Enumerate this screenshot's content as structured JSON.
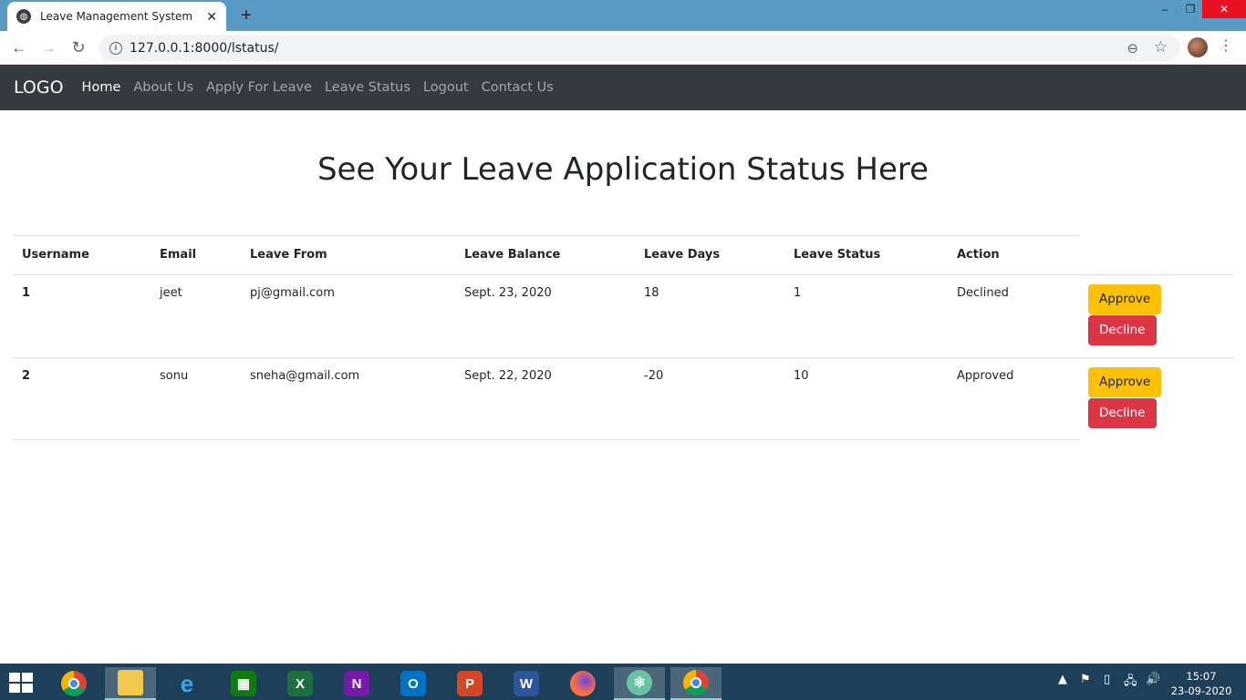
{
  "browser": {
    "tab_title": "Leave Management System",
    "tab_close": "✕",
    "new_tab": "+",
    "url": "127.0.0.1:8000/lstatus/",
    "window_controls": [
      "–",
      "❐",
      "✕"
    ]
  },
  "navbar": {
    "brand": "LOGO",
    "links": [
      "Home",
      "About Us",
      "Apply For Leave",
      "Leave Status",
      "Logout",
      "Contact Us"
    ],
    "active": "Home"
  },
  "page": {
    "heading": "See Your Leave Application Status Here"
  },
  "table": {
    "headers": [
      "Username",
      "Email",
      "Leave From",
      "Leave Balance",
      "Leave Days",
      "Leave Status",
      "Action"
    ],
    "rows": [
      {
        "id": "1",
        "username": "jeet",
        "email": "pj@gmail.com",
        "leave_from": "Sept. 23, 2020",
        "balance": "18",
        "days": "1",
        "status": "Declined"
      },
      {
        "id": "2",
        "username": "sonu",
        "email": "sneha@gmail.com",
        "leave_from": "Sept. 22, 2020",
        "balance": "-20",
        "days": "10",
        "status": "Approved"
      }
    ],
    "approve_label": "Approve",
    "decline_label": "Decline",
    "colors": {
      "approve": "#ffc107",
      "decline": "#dc3545"
    }
  },
  "taskbar": {
    "apps": [
      "chrome-icon",
      "file-explorer-icon",
      "internet-explorer-icon",
      "store-icon",
      "excel-icon",
      "onenote-icon",
      "outlook-icon",
      "powerpoint-icon",
      "word-icon",
      "firefox-icon",
      "atom-icon",
      "chrome-active-icon"
    ],
    "time": "15:07",
    "date": "23-09-2020"
  }
}
